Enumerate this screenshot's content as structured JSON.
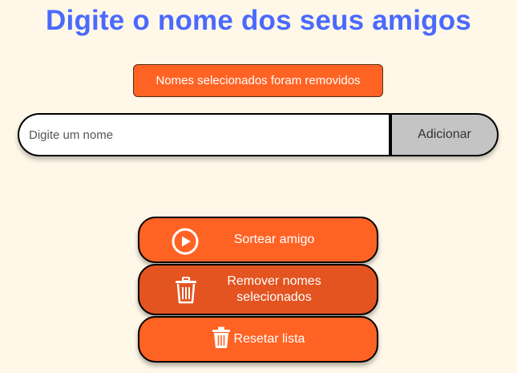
{
  "page": {
    "title": "Digite o nome dos seus amigos"
  },
  "notice": {
    "text": "Nomes selecionados foram removidos"
  },
  "form": {
    "input_placeholder": "Digite um nome",
    "input_value": "",
    "add_label": "Adicionar"
  },
  "actions": {
    "draw_label": "Sortear amigo",
    "draw_icon": "play-circle-icon",
    "remove_label": "Remover nomes selecionados",
    "remove_icon": "trash-icon",
    "reset_label": "Resetar lista",
    "reset_icon": "trash-icon"
  },
  "colors": {
    "background": "#fff8e8",
    "title": "#4b69fd",
    "accent": "#ff6324",
    "accent_pressed": "#e35420",
    "add_button": "#c4c4c4"
  }
}
